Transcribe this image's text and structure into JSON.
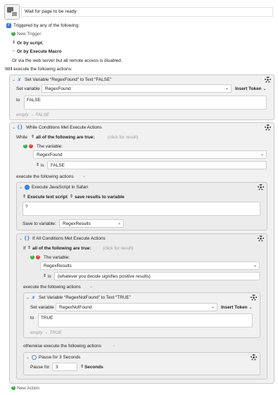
{
  "macro": {
    "title": "Wait for page to be ready",
    "triggered_label": "Triggered by any of the following:",
    "new_trigger": "New Trigger",
    "or_by_script": "Or by script.",
    "or_by_execute_macro": "Or by Execute Macro",
    "web_server_note": "Or via the web server but all remote access is disabled.",
    "will_execute": "Will execute the following actions:",
    "new_action": "New Action"
  },
  "action1": {
    "title": "Set Variable “RegexFound” to Text “FALSE”",
    "set_variable_label": "Set variable",
    "variable": "RegexFound",
    "insert_token": "Insert Token",
    "to_label": "to",
    "value": "FALSE",
    "status": "empty → FALSE"
  },
  "while": {
    "title": "While Conditions Met Execute Actions",
    "while_label": "While",
    "all_label": "all of the following are true:",
    "click_result": "(click for result)",
    "condition_label": "The variable:",
    "variable": "RegexFound",
    "is_label": "is",
    "value": "FALSE",
    "execute_label": "execute the following actions"
  },
  "js": {
    "title": "Execute JavaScript in Safari",
    "mode": "Execute text script",
    "save_mode": "save results to variable",
    "script": "?",
    "save_to_label": "Save to variable:",
    "save_to_var": "RegexResults"
  },
  "ifaction": {
    "title": "If All Conditions Met Execute Actions",
    "if_label": "If",
    "all_label": "all of the following are true:",
    "click_result": "(click for result)",
    "condition_label": "The variable:",
    "variable": "RegexResults",
    "is_label": "is",
    "value": "(whatever you decide signifies positive results)",
    "execute_label": "execute the following actions",
    "otherwise_label": "otherwise execute the following actions"
  },
  "action2": {
    "title": "Set Variable “RegexNotFound” to Text “TRUE”",
    "set_variable_label": "Set variable",
    "variable": "RegexNotFound",
    "insert_token": "Insert Token",
    "to_label": "to",
    "value": "TRUE",
    "status": "empty → TRUE"
  },
  "pause": {
    "title": "Pause for 3 Seconds",
    "pause_for_label": "Pause for",
    "amount": "3",
    "unit": "Seconds"
  },
  "colors": {
    "accent": "#3a7bd5",
    "add": "#3daa48",
    "remove": "#d9463d"
  },
  "icons": [
    "macro-icon",
    "checkbox-icon",
    "plus-icon",
    "updown-icon",
    "chevron-down-icon",
    "gear-icon",
    "variable-icon",
    "braces-icon",
    "safari-icon",
    "clock-icon"
  ]
}
